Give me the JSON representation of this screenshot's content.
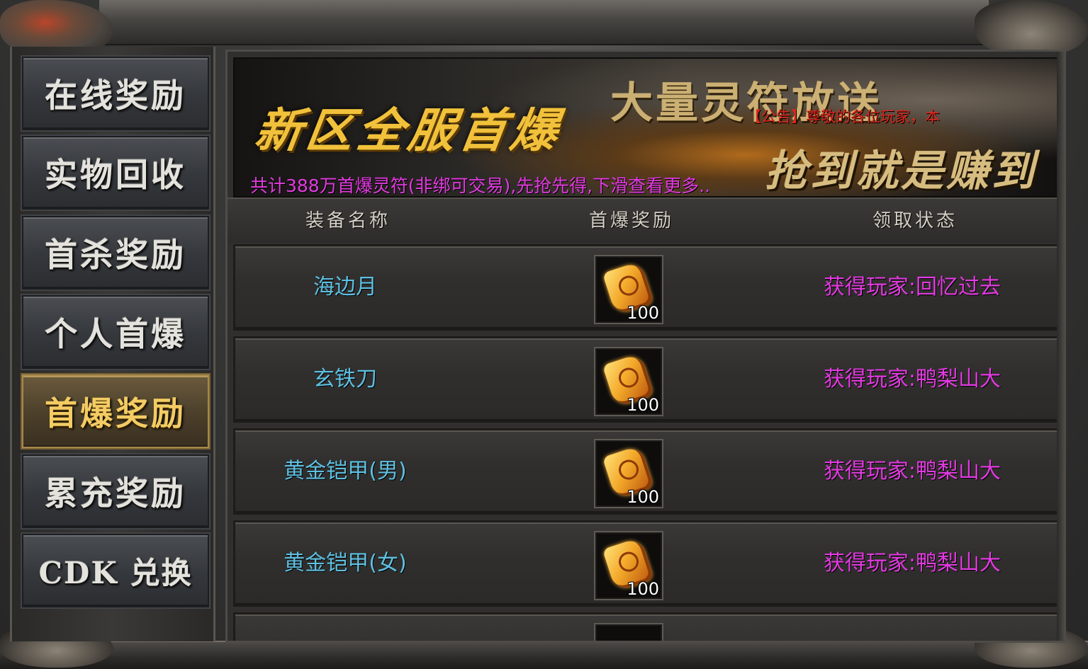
{
  "sidebar": {
    "items": [
      {
        "label": "在线奖励",
        "active": false
      },
      {
        "label": "实物回收",
        "active": false
      },
      {
        "label": "首杀奖励",
        "active": false
      },
      {
        "label": "个人首爆",
        "active": false
      },
      {
        "label": "首爆奖励",
        "active": true
      },
      {
        "label": "累充奖励",
        "active": false
      },
      {
        "label": "CDK 兑换",
        "active": false
      }
    ]
  },
  "banner": {
    "title": "新区全服首爆",
    "slogan_top": "大量灵符放送",
    "slogan_bottom": "抢到就是赚到",
    "notice": "【公告】尊敬的各位玩家，本",
    "description": "共计388万首爆灵符(非绑可交易),先抢先得,下滑查看更多.."
  },
  "table": {
    "headers": [
      "装备名称",
      "首爆奖励",
      "领取状态"
    ],
    "rows": [
      {
        "name": "海边月",
        "reward_icon": "lingfu-talisman-icon",
        "reward_qty": "100",
        "status": "获得玩家:回忆过去"
      },
      {
        "name": "玄铁刀",
        "reward_icon": "lingfu-talisman-icon",
        "reward_qty": "100",
        "status": "获得玩家:鸭梨山大"
      },
      {
        "name": "黄金铠甲(男)",
        "reward_icon": "lingfu-talisman-icon",
        "reward_qty": "100",
        "status": "获得玩家:鸭梨山大"
      },
      {
        "name": "黄金铠甲(女)",
        "reward_icon": "lingfu-talisman-icon",
        "reward_qty": "100",
        "status": "获得玩家:鸭梨山大"
      }
    ]
  },
  "colors": {
    "name_text": "#5ec0e2",
    "status_text": "#e23ae0",
    "active_tab_text": "#f3cc63",
    "notice_text": "#e0261c"
  }
}
